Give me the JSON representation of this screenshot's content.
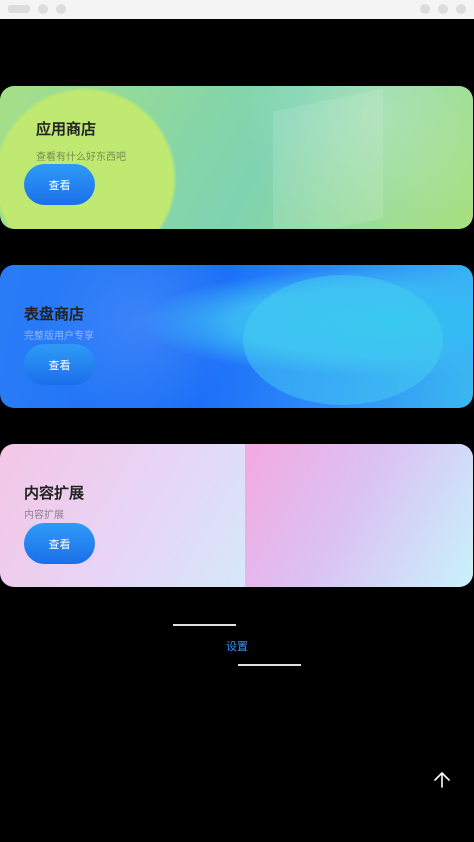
{
  "cards": [
    {
      "title": "应用商店",
      "subtitle": "查看有什么好东西吧",
      "button": "查看"
    },
    {
      "title": "表盘商店",
      "subtitle": "完整版用户专享",
      "button": "查看"
    },
    {
      "title": "内容扩展",
      "subtitle": "内容扩展",
      "button": "查看"
    }
  ],
  "settings": {
    "label": "设置"
  },
  "icons": {
    "status_left": [
      "status-bar-icon"
    ],
    "back_to_top": "arrow-up-icon"
  },
  "colors": {
    "background": "#000000",
    "button": "#1b6fe9",
    "link": "#3f8ff0"
  }
}
